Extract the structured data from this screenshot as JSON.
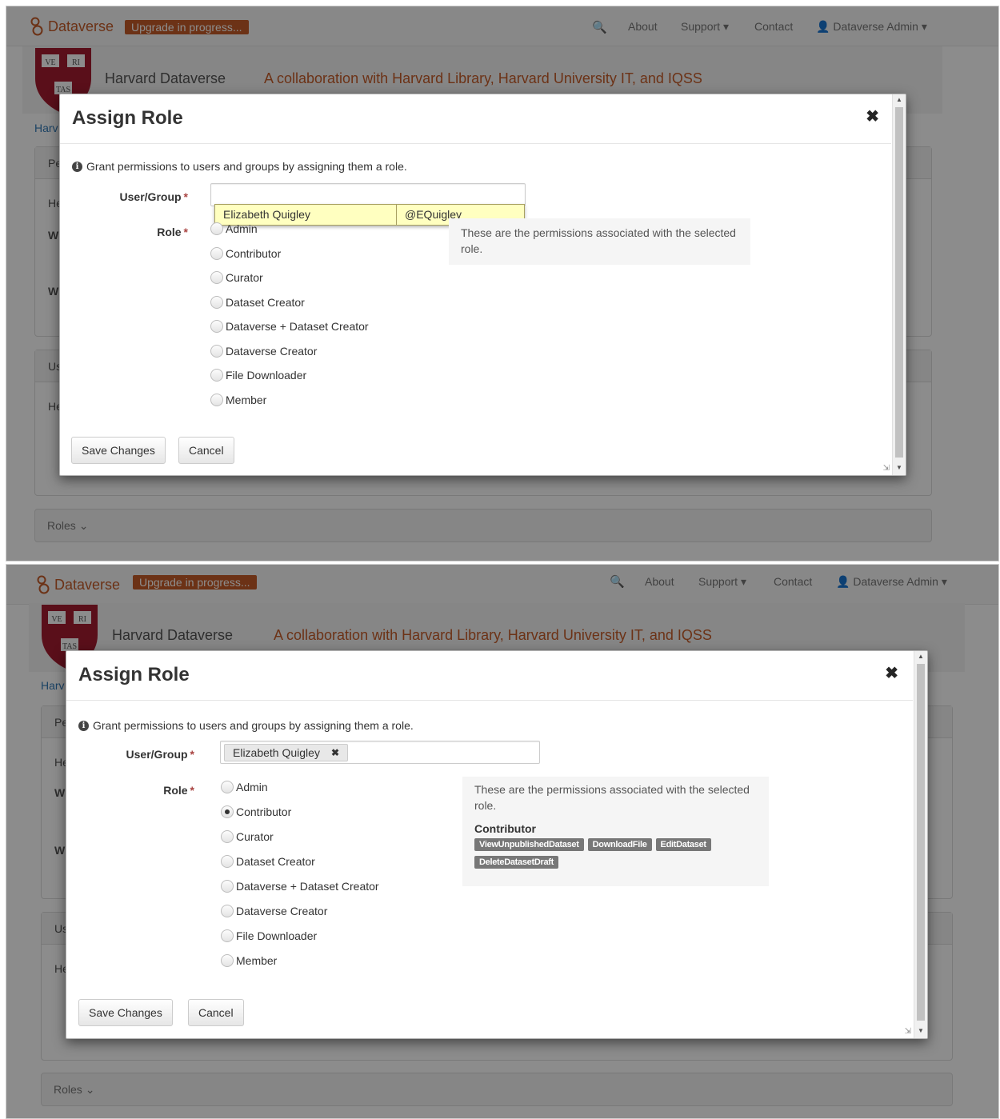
{
  "navbar": {
    "brand": "Dataverse",
    "upgrade_badge": "Upgrade in progress...",
    "about": "About",
    "support": "Support",
    "contact": "Contact",
    "user_menu": "Dataverse Admin"
  },
  "header": {
    "site_name": "Harvard Dataverse",
    "tagline": "A collaboration with Harvard Library, Harvard University IT, and IQSS",
    "shield_text": [
      "VE",
      "RI",
      "TAS"
    ],
    "breadcrumb_partial": "Harv"
  },
  "background": {
    "panel1_head": "Pe",
    "help_partial": "He",
    "row_w1": "W",
    "row_w2": "W",
    "panel2_head": "Us",
    "roles_toggle": "Roles"
  },
  "modal": {
    "title": "Assign Role",
    "help_text": "Grant permissions to users and groups by assigning them a role.",
    "user_group_label": "User/Group",
    "role_label": "Role",
    "required_mark": "*",
    "roles": [
      "Admin",
      "Contributor",
      "Curator",
      "Dataset Creator",
      "Dataverse + Dataset Creator",
      "Dataverse Creator",
      "File Downloader",
      "Member"
    ],
    "permissions_intro": "These are the permissions associated with the selected role.",
    "save_button": "Save Changes",
    "cancel_button": "Cancel"
  },
  "state_before": {
    "user_group_value": "",
    "suggestion_name": "Elizabeth Quigley",
    "suggestion_handle": "@EQuigley"
  },
  "state_after": {
    "user_group_token": "Elizabeth Quigley",
    "selected_role": "Contributor",
    "selected_role_title": "Contributor",
    "permissions": [
      "ViewUnpublishedDataset",
      "DownloadFile",
      "EditDataset",
      "DeleteDatasetDraft"
    ]
  },
  "colors": {
    "brand": "#c55b28",
    "suggestion_bg": "#ffffc0",
    "permission_tag": "#777777"
  }
}
